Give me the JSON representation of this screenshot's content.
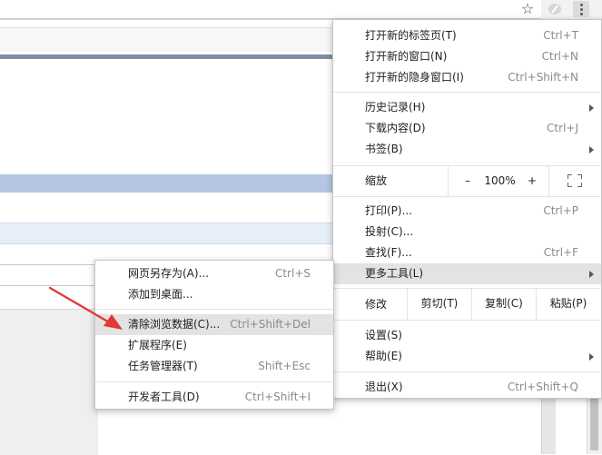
{
  "toolbar": {
    "star_icon": "star-icon",
    "extension_icon": "extension-icon",
    "menu_icon": "more-vert-icon"
  },
  "main_menu": {
    "new_tab": {
      "label": "打开新的标签页(T)",
      "shortcut": "Ctrl+T"
    },
    "new_window": {
      "label": "打开新的窗口(N)",
      "shortcut": "Ctrl+N"
    },
    "new_incognito": {
      "label": "打开新的隐身窗口(I)",
      "shortcut": "Ctrl+Shift+N"
    },
    "history": {
      "label": "历史记录(H)"
    },
    "downloads": {
      "label": "下载内容(D)",
      "shortcut": "Ctrl+J"
    },
    "bookmarks": {
      "label": "书签(B)"
    },
    "zoom": {
      "label": "缩放",
      "minus": "–",
      "value": "100%",
      "plus": "+",
      "fullscreen_icon": "fullscreen-icon"
    },
    "print": {
      "label": "打印(P)...",
      "shortcut": "Ctrl+P"
    },
    "cast": {
      "label": "投射(C)..."
    },
    "find": {
      "label": "查找(F)...",
      "shortcut": "Ctrl+F"
    },
    "more_tools": {
      "label": "更多工具(L)"
    },
    "edit": {
      "label": "修改",
      "cut": "剪切(T)",
      "copy": "复制(C)",
      "paste": "粘贴(P)"
    },
    "settings": {
      "label": "设置(S)"
    },
    "help": {
      "label": "帮助(E)"
    },
    "exit": {
      "label": "退出(X)",
      "shortcut": "Ctrl+Shift+Q"
    }
  },
  "sub_menu": {
    "save_page": {
      "label": "网页另存为(A)...",
      "shortcut": "Ctrl+S"
    },
    "add_to_desktop": {
      "label": "添加到桌面..."
    },
    "clear_browsing": {
      "label": "清除浏览数据(C)...",
      "shortcut": "Ctrl+Shift+Del"
    },
    "extensions": {
      "label": "扩展程序(E)"
    },
    "task_manager": {
      "label": "任务管理器(T)",
      "shortcut": "Shift+Esc"
    },
    "dev_tools": {
      "label": "开发者工具(D)",
      "shortcut": "Ctrl+Shift+I"
    }
  },
  "colors": {
    "highlight": "#e3e3e3",
    "annotation_arrow": "#e53935"
  }
}
